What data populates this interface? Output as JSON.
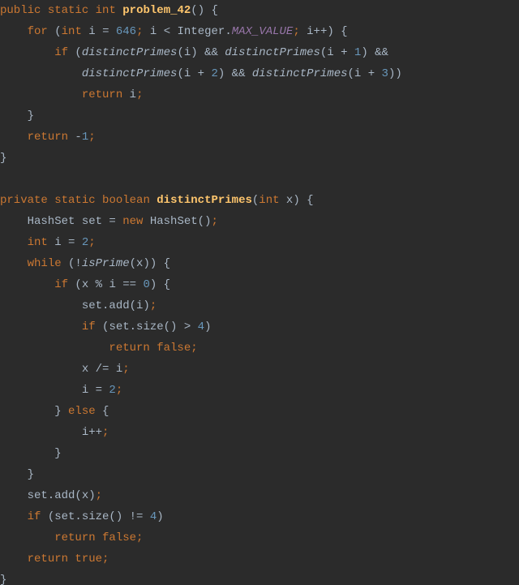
{
  "code": {
    "tokens": [
      [
        [
          "kw",
          "public"
        ],
        [
          "sp",
          " "
        ],
        [
          "kw",
          "static"
        ],
        [
          "sp",
          " "
        ],
        [
          "kw",
          "int"
        ],
        [
          "sp",
          " "
        ],
        [
          "fn",
          "problem_42"
        ],
        [
          "op",
          "() {"
        ]
      ],
      [
        [
          "sp",
          "    "
        ],
        [
          "kw",
          "for"
        ],
        [
          "sp",
          " "
        ],
        [
          "op",
          "("
        ],
        [
          "kw",
          "int"
        ],
        [
          "sp",
          " i = "
        ],
        [
          "num",
          "646"
        ],
        [
          "semi",
          ";"
        ],
        [
          "sp",
          " i < Integer."
        ],
        [
          "sf",
          "MAX_VALUE"
        ],
        [
          "semi",
          ";"
        ],
        [
          "sp",
          " i++) {"
        ]
      ],
      [
        [
          "sp",
          "        "
        ],
        [
          "kw",
          "if"
        ],
        [
          "sp",
          " ("
        ],
        [
          "call",
          "distinctPrimes"
        ],
        [
          "op",
          "(i) && "
        ],
        [
          "call",
          "distinctPrimes"
        ],
        [
          "op",
          "(i + "
        ],
        [
          "num",
          "1"
        ],
        [
          "op",
          ") &&"
        ]
      ],
      [
        [
          "sp",
          "            "
        ],
        [
          "call",
          "distinctPrimes"
        ],
        [
          "op",
          "(i + "
        ],
        [
          "num",
          "2"
        ],
        [
          "op",
          ") && "
        ],
        [
          "call",
          "distinctPrimes"
        ],
        [
          "op",
          "(i + "
        ],
        [
          "num",
          "3"
        ],
        [
          "op",
          "))"
        ]
      ],
      [
        [
          "sp",
          "            "
        ],
        [
          "kw",
          "return"
        ],
        [
          "sp",
          " i"
        ],
        [
          "semi",
          ";"
        ]
      ],
      [
        [
          "sp",
          "    }"
        ]
      ],
      [
        [
          "sp",
          "    "
        ],
        [
          "kw",
          "return"
        ],
        [
          "sp",
          " -"
        ],
        [
          "num",
          "1"
        ],
        [
          "semi",
          ";"
        ]
      ],
      [
        [
          "op",
          "}"
        ]
      ],
      [
        [
          "sp",
          ""
        ]
      ],
      [
        [
          "kw",
          "private"
        ],
        [
          "sp",
          " "
        ],
        [
          "kw",
          "static"
        ],
        [
          "sp",
          " "
        ],
        [
          "kw",
          "boolean"
        ],
        [
          "sp",
          " "
        ],
        [
          "fn",
          "distinctPrimes"
        ],
        [
          "op",
          "("
        ],
        [
          "kw",
          "int"
        ],
        [
          "sp",
          " x) {"
        ]
      ],
      [
        [
          "sp",
          "    HashSet set = "
        ],
        [
          "kw",
          "new"
        ],
        [
          "sp",
          " HashSet()"
        ],
        [
          "semi",
          ";"
        ]
      ],
      [
        [
          "sp",
          "    "
        ],
        [
          "kw",
          "int"
        ],
        [
          "sp",
          " i = "
        ],
        [
          "num",
          "2"
        ],
        [
          "semi",
          ";"
        ]
      ],
      [
        [
          "sp",
          "    "
        ],
        [
          "kw",
          "while"
        ],
        [
          "sp",
          " (!"
        ],
        [
          "call",
          "isPrime"
        ],
        [
          "op",
          "(x)) {"
        ]
      ],
      [
        [
          "sp",
          "        "
        ],
        [
          "kw",
          "if"
        ],
        [
          "sp",
          " (x % i == "
        ],
        [
          "num",
          "0"
        ],
        [
          "op",
          ") {"
        ]
      ],
      [
        [
          "sp",
          "            set.add(i)"
        ],
        [
          "semi",
          ";"
        ]
      ],
      [
        [
          "sp",
          "            "
        ],
        [
          "kw",
          "if"
        ],
        [
          "sp",
          " (set.size() > "
        ],
        [
          "num",
          "4"
        ],
        [
          "op",
          ")"
        ]
      ],
      [
        [
          "sp",
          "                "
        ],
        [
          "kw",
          "return false"
        ],
        [
          "semi",
          ";"
        ]
      ],
      [
        [
          "sp",
          "            x /= i"
        ],
        [
          "semi",
          ";"
        ]
      ],
      [
        [
          "sp",
          "            i = "
        ],
        [
          "num",
          "2"
        ],
        [
          "semi",
          ";"
        ]
      ],
      [
        [
          "sp",
          "        } "
        ],
        [
          "kw",
          "else"
        ],
        [
          "sp",
          " {"
        ]
      ],
      [
        [
          "sp",
          "            i++"
        ],
        [
          "semi",
          ";"
        ]
      ],
      [
        [
          "sp",
          "        }"
        ]
      ],
      [
        [
          "sp",
          "    }"
        ]
      ],
      [
        [
          "sp",
          "    set.add(x)"
        ],
        [
          "semi",
          ";"
        ]
      ],
      [
        [
          "sp",
          "    "
        ],
        [
          "kw",
          "if"
        ],
        [
          "sp",
          " (set.size() != "
        ],
        [
          "num",
          "4"
        ],
        [
          "op",
          ")"
        ]
      ],
      [
        [
          "sp",
          "        "
        ],
        [
          "kw",
          "return false"
        ],
        [
          "semi",
          ";"
        ]
      ],
      [
        [
          "sp",
          "    "
        ],
        [
          "kw",
          "return true"
        ],
        [
          "semi",
          ";"
        ]
      ],
      [
        [
          "op",
          "}"
        ]
      ]
    ]
  }
}
